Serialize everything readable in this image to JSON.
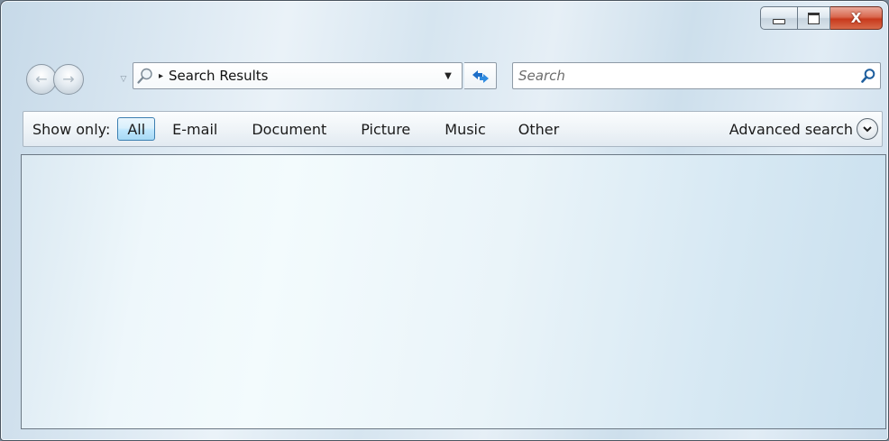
{
  "window": {
    "caption_buttons": {
      "minimize_icon": "minimize-icon",
      "maximize_icon": "maximize-icon",
      "close_label": "X"
    }
  },
  "navigation": {
    "back_icon": "back-arrow-icon",
    "forward_icon": "forward-arrow-icon",
    "recent_pages_icon": "chevron-down-icon",
    "address": {
      "icon": "search-folder-icon",
      "separator": "▸",
      "path": "Search Results",
      "dropdown_icon": "dropdown-arrow-icon"
    },
    "refresh_icon": "refresh-icon",
    "search": {
      "placeholder": "Search",
      "value": "",
      "icon": "magnifier-icon"
    }
  },
  "filter_bar": {
    "show_only_label": "Show only:",
    "filters": [
      {
        "label": "All",
        "active": true
      },
      {
        "label": "E-mail",
        "active": false
      },
      {
        "label": "Document",
        "active": false
      },
      {
        "label": "Picture",
        "active": false
      },
      {
        "label": "Music",
        "active": false
      },
      {
        "label": "Other",
        "active": false
      }
    ],
    "advanced_search_label": "Advanced search",
    "advanced_icon": "chevron-down-circle-icon"
  },
  "colors": {
    "active_filter_border": "#3c7fb1",
    "close_button": "#c8391c",
    "refresh_blue": "#1e6fc8"
  }
}
